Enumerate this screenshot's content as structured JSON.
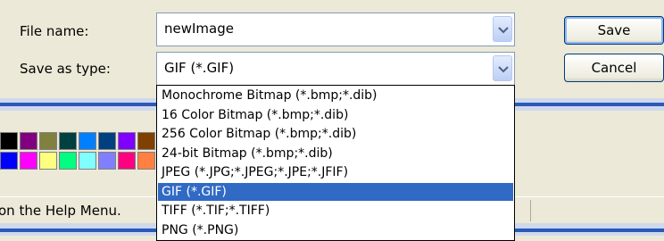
{
  "dialog": {
    "file_name_label": "File name:",
    "file_name_value": "newImage",
    "save_as_type_label": "Save as type:",
    "save_as_type_value": "GIF (*.GIF)",
    "save_label": "Save",
    "cancel_label": "Cancel"
  },
  "type_options": [
    {
      "label": "Monochrome Bitmap (*.bmp;*.dib)",
      "selected": false
    },
    {
      "label": "16 Color Bitmap (*.bmp;*.dib)",
      "selected": false
    },
    {
      "label": "256 Color Bitmap (*.bmp;*.dib)",
      "selected": false
    },
    {
      "label": "24-bit Bitmap (*.bmp;*.dib)",
      "selected": false
    },
    {
      "label": "JPEG (*.JPG;*.JPEG;*.JPE;*.JFIF)",
      "selected": false
    },
    {
      "label": "GIF (*.GIF)",
      "selected": true
    },
    {
      "label": "TIFF (*.TIF;*.TIFF)",
      "selected": false
    },
    {
      "label": "PNG (*.PNG)",
      "selected": false
    }
  ],
  "status_text": "on the Help Menu.",
  "palette": {
    "top_row": [
      "#000000",
      "#800080",
      "#808040",
      "#004040",
      "#0080ff",
      "#004080",
      "#8000ff",
      "#804000"
    ],
    "bottom_row": [
      "#0000ff",
      "#ff00ff",
      "#ffff80",
      "#00ff80",
      "#80ffff",
      "#8080ff",
      "#ff0080",
      "#ff8040"
    ]
  },
  "colors": {
    "selection": "#316ac5",
    "title_blue": "#2b59b7"
  }
}
